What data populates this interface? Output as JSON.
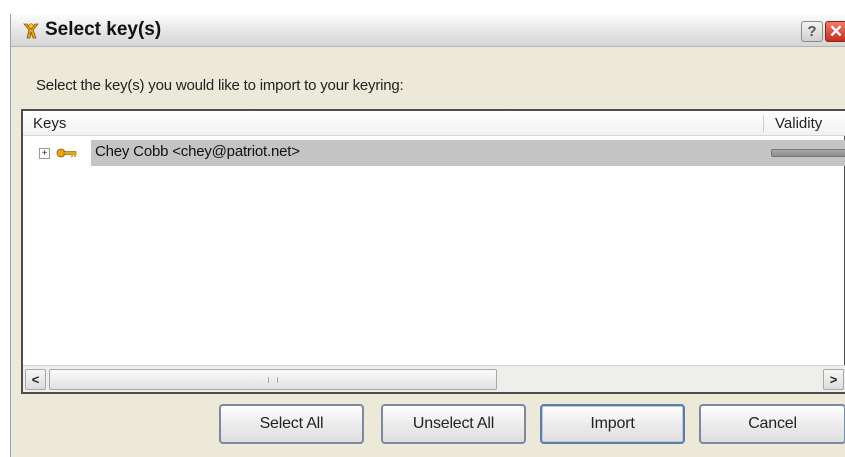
{
  "window": {
    "title": "Select key(s)",
    "help_label": "?",
    "close_label": "✕"
  },
  "instruction": "Select the key(s) you would like to import to your keyring:",
  "list": {
    "columns": [
      "Keys",
      "Validity"
    ],
    "rows": [
      {
        "expander": "+",
        "name": "Chey Cobb <chey@patriot.net>",
        "selected": true,
        "validity_fill": 1.0
      }
    ]
  },
  "scrollbar": {
    "left_arrow": "<",
    "right_arrow": ">"
  },
  "buttons": {
    "select_all": "Select All",
    "unselect_all": "Unselect All",
    "import": "Import",
    "cancel": "Cancel"
  },
  "colors": {
    "dialog_bg": "#ece9d8",
    "selection_bg": "#c4c4c4",
    "close_red": "#c1301f",
    "key_icon": "#e8a317"
  },
  "icons": {
    "title": "keys-icon",
    "row": "key-icon"
  }
}
